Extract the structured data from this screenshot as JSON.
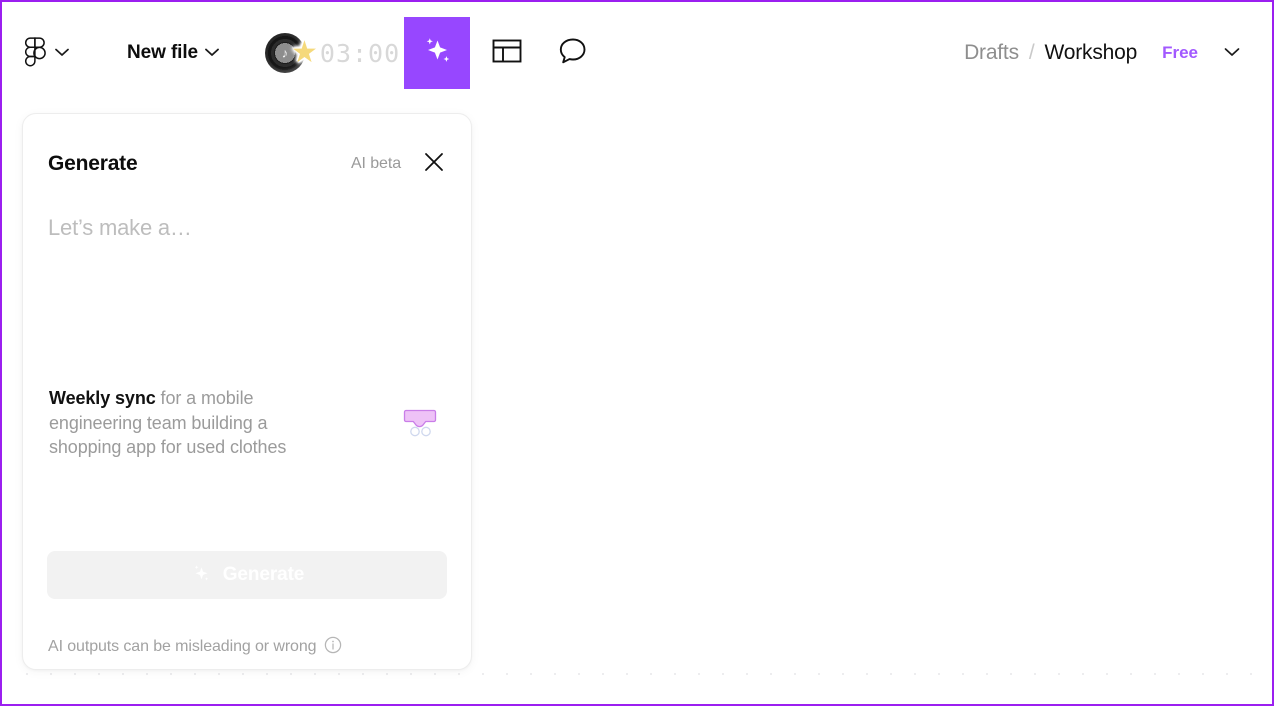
{
  "app": {
    "name": "Figma",
    "accent_purple": "#9747ff",
    "plan_purple": "#a259ff",
    "recording_border": "#9b1ff0"
  },
  "toolbar": {
    "main_menu_icon": "figma-logo-icon",
    "main_menu_chevron_icon": "chevron-down-icon",
    "file_label": "New file",
    "file_chevron_icon": "chevron-down-icon",
    "music_widget": {
      "record_icon": "vinyl-record-icon",
      "star_icon": "star-icon",
      "timer": "03:00"
    },
    "tools": [
      {
        "name": "ai-generate-tool",
        "icon": "sparkle-icon",
        "active": true
      },
      {
        "name": "layout-grid-tool",
        "icon": "layout-panel-icon",
        "active": false
      },
      {
        "name": "comment-tool",
        "icon": "comment-bubble-icon",
        "active": false
      }
    ],
    "breadcrumb": {
      "parent": "Drafts",
      "separator": "/",
      "current": "Workshop"
    },
    "plan_badge": "Free",
    "account_chevron_icon": "chevron-down-icon"
  },
  "generate_panel": {
    "title": "Generate",
    "beta_label": "AI beta",
    "close_icon": "close-icon",
    "prompt_placeholder": "Let’s make a…",
    "prompt_value": "",
    "suggestion": {
      "bold_text": "Weekly sync",
      "rest_text": " for a mobile engineering team building a shopping app for used clothes",
      "thumbnail_icon": "table-layout-thumbnail-icon"
    },
    "generate_button": {
      "label": "Generate",
      "icon": "sparkle-icon",
      "disabled": true
    },
    "footer": {
      "disclaimer": "AI outputs can be misleading or wrong",
      "info_icon": "info-circle-icon"
    }
  },
  "canvas": {
    "ruler_dot_count": 53,
    "ruler_dot_spacing": 24
  }
}
